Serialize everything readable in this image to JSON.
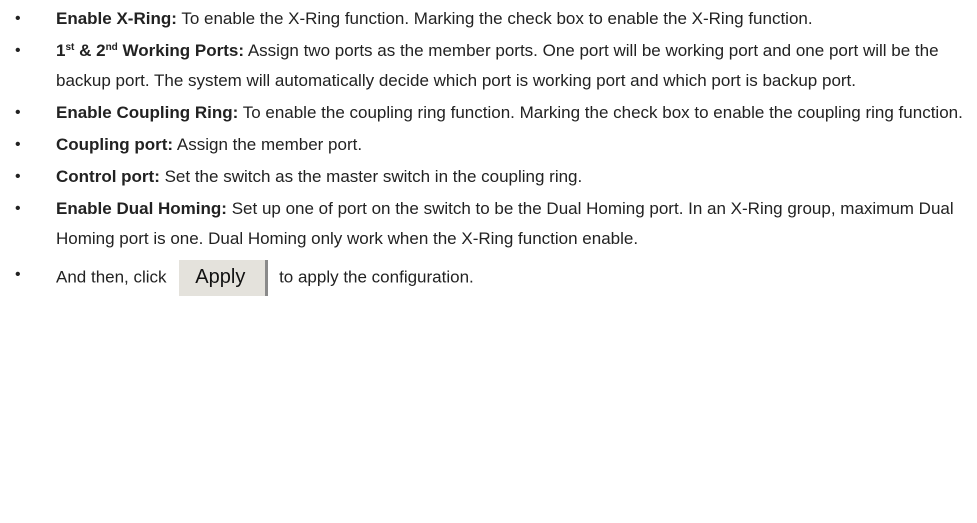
{
  "items": [
    {
      "term": "Enable X-Ring:",
      "text": "To enable the X-Ring function. Marking the check box to enable the X-Ring function."
    },
    {
      "term_parts": [
        "1",
        "st",
        " & 2",
        "nd",
        " Working Ports:"
      ],
      "text": "Assign two ports as the member ports. One port will be working port and one port will be the backup port. The system will automatically decide which port is working port and which port is backup port."
    },
    {
      "term": "Enable Coupling Ring:",
      "text": "To enable the coupling ring function. Marking the check box to enable the coupling ring function."
    },
    {
      "term": "Coupling port:",
      "text": "Assign the member port."
    },
    {
      "term": "Control port:",
      "text": "Set the switch as the master switch in the coupling ring."
    },
    {
      "term": "Enable Dual Homing:",
      "text": "Set up one of port on the switch to be the Dual Homing port. In an X-Ring group, maximum Dual Homing port is one. Dual Homing only work when the X-Ring function enable."
    }
  ],
  "apply_line": {
    "before": "And then, click",
    "button_label": "Apply",
    "after": "to apply the configuration."
  },
  "bullet_glyph": "•"
}
